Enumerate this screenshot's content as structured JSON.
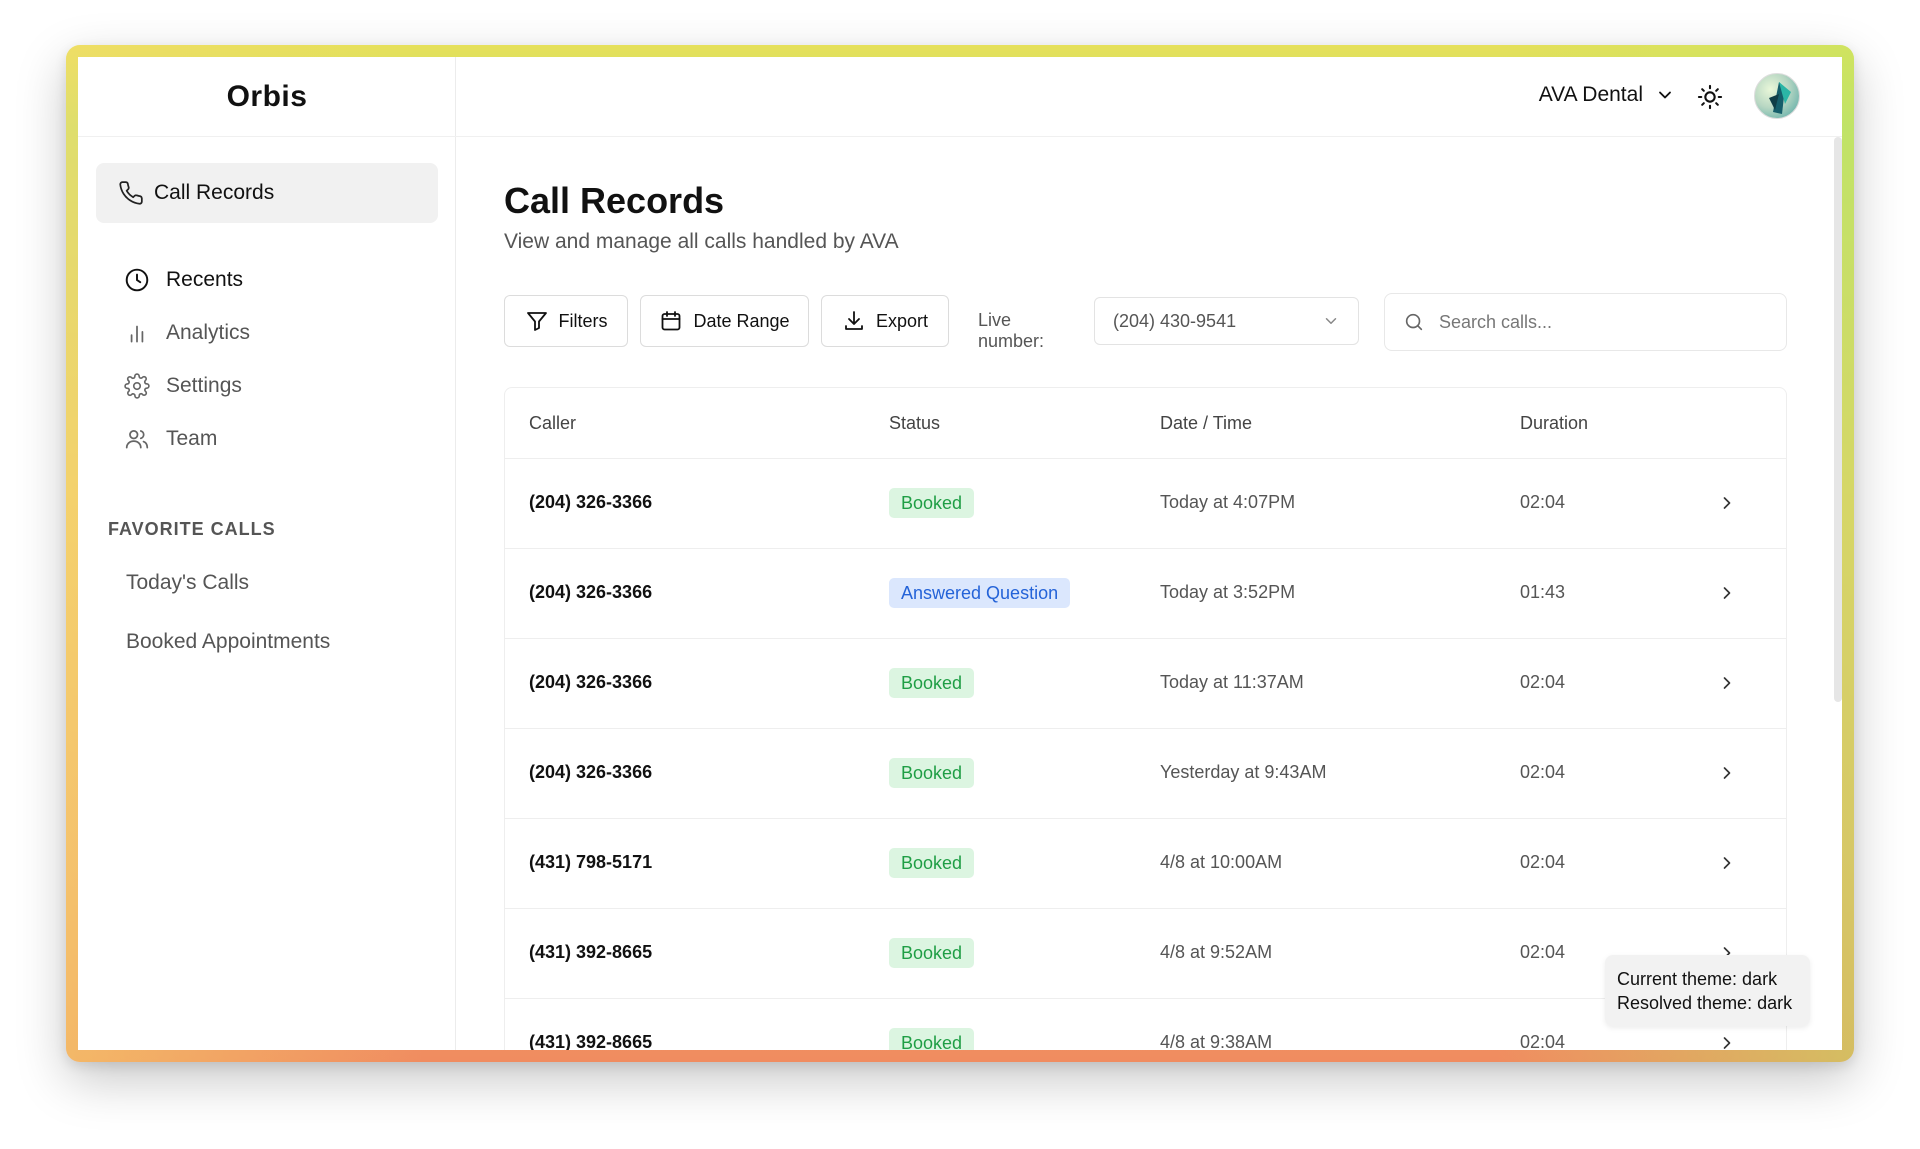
{
  "app": {
    "logo": "Orbis"
  },
  "sidebar": {
    "active_item": {
      "label": "Call Records",
      "icon": "phone-icon"
    },
    "items": [
      {
        "label": "Recents",
        "icon": "clock-icon"
      },
      {
        "label": "Analytics",
        "icon": "bar-chart-icon"
      },
      {
        "label": "Settings",
        "icon": "gear-icon"
      },
      {
        "label": "Team",
        "icon": "users-icon"
      }
    ],
    "favorites_title": "FAVORITE CALLS",
    "favorites": [
      {
        "label": "Today's Calls"
      },
      {
        "label": "Booked Appointments"
      }
    ]
  },
  "header": {
    "org_name": "AVA Dental",
    "theme_icon": "sun-icon",
    "avatar_icon": "avatar"
  },
  "main": {
    "title": "Call Records",
    "subtitle": "View and manage all calls handled by AVA",
    "toolbar": {
      "filters_label": "Filters",
      "date_range_label": "Date Range",
      "export_label": "Export",
      "live_number_label": "Live number:",
      "live_number_value": "(204) 430-9541",
      "search_placeholder": "Search calls..."
    },
    "table": {
      "columns": [
        "Caller",
        "Status",
        "Date / Time",
        "Duration"
      ],
      "rows": [
        {
          "caller": "(204) 326-3366",
          "status": "Booked",
          "status_type": "booked",
          "datetime": "Today at 4:07PM",
          "duration": "02:04"
        },
        {
          "caller": "(204) 326-3366",
          "status": "Answered Question",
          "status_type": "answered",
          "datetime": "Today at 3:52PM",
          "duration": "01:43"
        },
        {
          "caller": "(204) 326-3366",
          "status": "Booked",
          "status_type": "booked",
          "datetime": "Today at 11:37AM",
          "duration": "02:04"
        },
        {
          "caller": "(204) 326-3366",
          "status": "Booked",
          "status_type": "booked",
          "datetime": "Yesterday at 9:43AM",
          "duration": "02:04"
        },
        {
          "caller": "(431) 798-5171",
          "status": "Booked",
          "status_type": "booked",
          "datetime": "4/8 at 10:00AM",
          "duration": "02:04"
        },
        {
          "caller": "(431) 392-8665",
          "status": "Booked",
          "status_type": "booked",
          "datetime": "4/8 at 9:52AM",
          "duration": "02:04"
        },
        {
          "caller": "(431) 392-8665",
          "status": "Booked",
          "status_type": "booked",
          "datetime": "4/8 at 9:38AM",
          "duration": "02:04"
        }
      ]
    }
  },
  "tooltip": {
    "line1": "Current theme: dark",
    "line2": "Resolved theme: dark"
  },
  "colors": {
    "booked_bg": "#dcf5e1",
    "booked_text": "#1f9e45",
    "answered_bg": "#dbe7fd",
    "answered_text": "#2463d8"
  }
}
